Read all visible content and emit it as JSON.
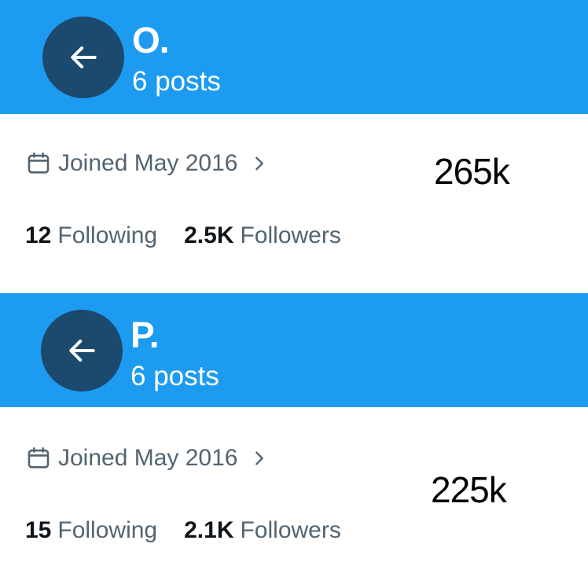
{
  "profiles": [
    {
      "name": "O.",
      "posts_label": "6 posts",
      "joined_label": "Joined May 2016",
      "following_count": "12",
      "following_label": "Following",
      "followers_count": "2.5K",
      "followers_label": "Followers",
      "annotation": "265k"
    },
    {
      "name": "P.",
      "posts_label": "6 posts",
      "joined_label": "Joined May 2016",
      "following_count": "15",
      "following_label": "Following",
      "followers_count": "2.1K",
      "followers_label": "Followers",
      "annotation": "225k"
    }
  ],
  "icons": {
    "back": "arrow-left-icon",
    "calendar": "calendar-icon",
    "chevron": "chevron-right-icon"
  },
  "colors": {
    "header_blue": "#1d9bf0",
    "back_button": "#1b4a6e",
    "secondary_text": "#536471",
    "primary_text": "#0f1419"
  }
}
